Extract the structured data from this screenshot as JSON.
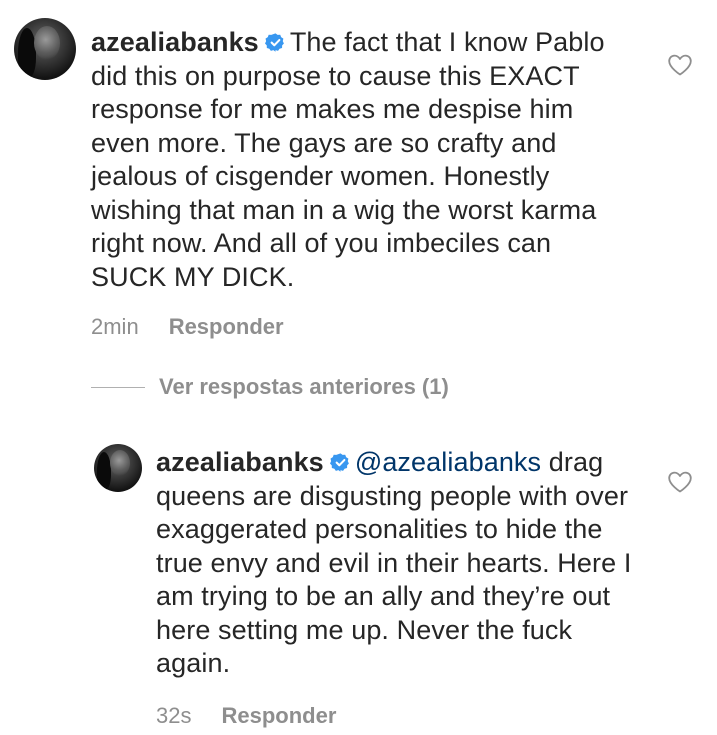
{
  "comments": [
    {
      "username": "azealiabanks",
      "verified": true,
      "text": "The fact that I know Pablo did this on purpose to cause this EXACT response for me makes me despise him even more. The gays are so crafty and jealous of cisgender women. Honestly wishing that man in a wig the worst karma right now. And all of you imbeciles can SUCK MY DICK.",
      "time": "2min",
      "reply_label": "Responder"
    }
  ],
  "view_replies_label": "Ver respostas anteriores (1)",
  "replies": [
    {
      "username": "azealiabanks",
      "verified": true,
      "mention": "@azealiabanks",
      "text": "drag queens are disgusting people with over exaggerated personalities to hide the true envy and evil in their hearts. Here I am trying to be an ally and they’re out here setting me up. Never the fuck again.",
      "time": "32s",
      "reply_label": "Responder"
    }
  ],
  "icons": {
    "verified": "verified-badge-icon",
    "like": "heart-outline-icon"
  },
  "colors": {
    "text": "#262626",
    "secondary": "#8e8e8e",
    "verified": "#3897f0",
    "mention": "#003569"
  }
}
